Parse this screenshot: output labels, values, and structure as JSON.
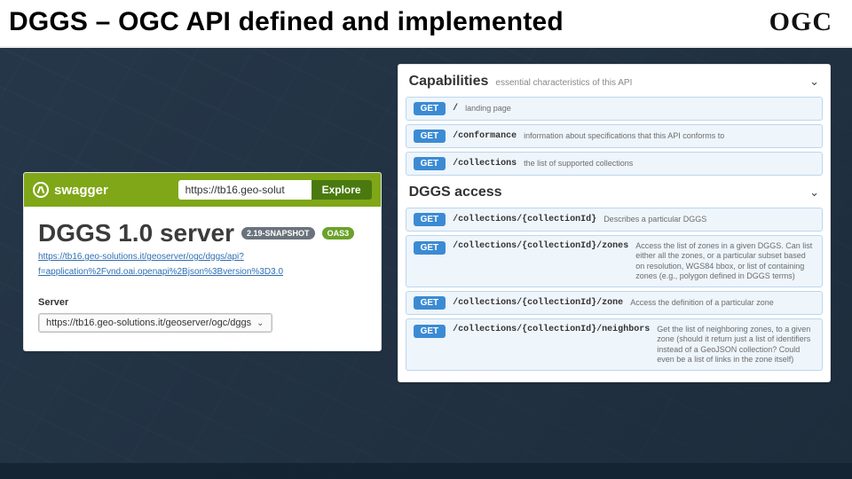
{
  "slide": {
    "title": "DGGS – OGC API defined and implemented",
    "brand": "OGC"
  },
  "swagger": {
    "brand": "swagger",
    "url_input": "https://tb16.geo-solut",
    "explore_label": "Explore",
    "heading": "DGGS 1.0 server",
    "badge_snapshot": "2.19-SNAPSHOT",
    "badge_oas": "OAS3",
    "doc_url_line1": "https://tb16.geo-solutions.it/geoserver/ogc/dggs/api?",
    "doc_url_line2": "f=application%2Fvnd.oai.openapi%2Bjson%3Bversion%3D3.0",
    "server_label": "Server",
    "server_value": "https://tb16.geo-solutions.it/geoserver/ogc/dggs"
  },
  "api": {
    "groups": [
      {
        "title": "Capabilities",
        "subtitle": "essential characteristics of this API",
        "endpoints": [
          {
            "verb": "GET",
            "path": "/",
            "desc": "landing page"
          },
          {
            "verb": "GET",
            "path": "/conformance",
            "desc": "information about specifications that this API conforms to"
          },
          {
            "verb": "GET",
            "path": "/collections",
            "desc": "the list of supported collections"
          }
        ]
      },
      {
        "title": "DGGS access",
        "subtitle": "",
        "endpoints": [
          {
            "verb": "GET",
            "path": "/collections/{collectionId}",
            "desc": "Describes a particular DGGS"
          },
          {
            "verb": "GET",
            "path": "/collections/{collectionId}/zones",
            "desc": "Access the list of zones in a given DGGS. Can list either all the zones, or a particular subset based on resolution, WGS84 bbox, or list of containing zones (e.g., polygon defined in DGGS terms)"
          },
          {
            "verb": "GET",
            "path": "/collections/{collectionId}/zone",
            "desc": "Access the definition of a particular zone"
          },
          {
            "verb": "GET",
            "path": "/collections/{collectionId}/neighbors",
            "desc": "Get the list of neighboring zones, to a given zone (should it return just a list of identifiers instead of a GeoJSON collection? Could even be a list of links in the zone itself)"
          }
        ]
      }
    ]
  }
}
